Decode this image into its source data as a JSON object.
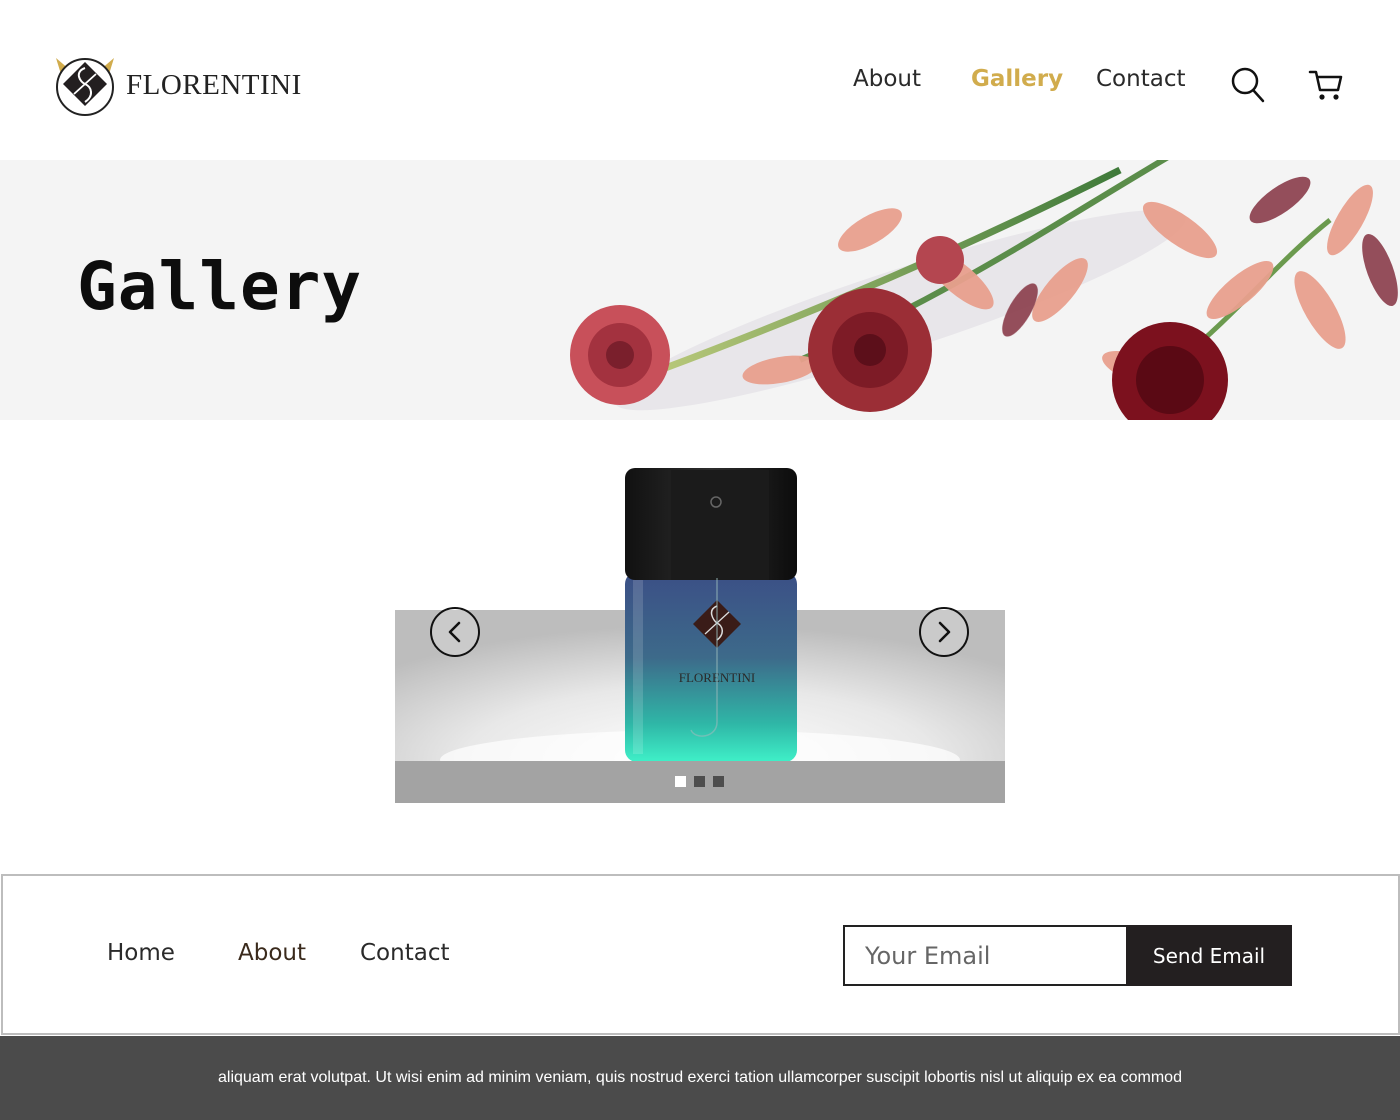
{
  "brand": {
    "name": "FLORENTINI",
    "accent": "#d1ac4d"
  },
  "nav": {
    "items": [
      {
        "label": "About",
        "active": false
      },
      {
        "label": "Gallery",
        "active": true
      },
      {
        "label": "Contact",
        "active": false
      }
    ],
    "search_icon": "search-icon",
    "cart_icon": "cart-icon"
  },
  "hero": {
    "title": "Gallery"
  },
  "carousel": {
    "product_label": "FLORENTINI",
    "slide_count": 3,
    "active_slide": 1,
    "prev_icon": "chevron-left-icon",
    "next_icon": "chevron-right-icon"
  },
  "footer": {
    "links": [
      {
        "label": "Home"
      },
      {
        "label": "About"
      },
      {
        "label": "Contact"
      }
    ],
    "email_placeholder": "Your Email",
    "send_label": "Send Email"
  },
  "bottom": {
    "text": "aliquam erat volutpat. Ut wisi enim ad minim veniam, quis nostrud exerci tation ullamcorper suscipit lobortis nisl ut aliquip ex ea commod"
  }
}
